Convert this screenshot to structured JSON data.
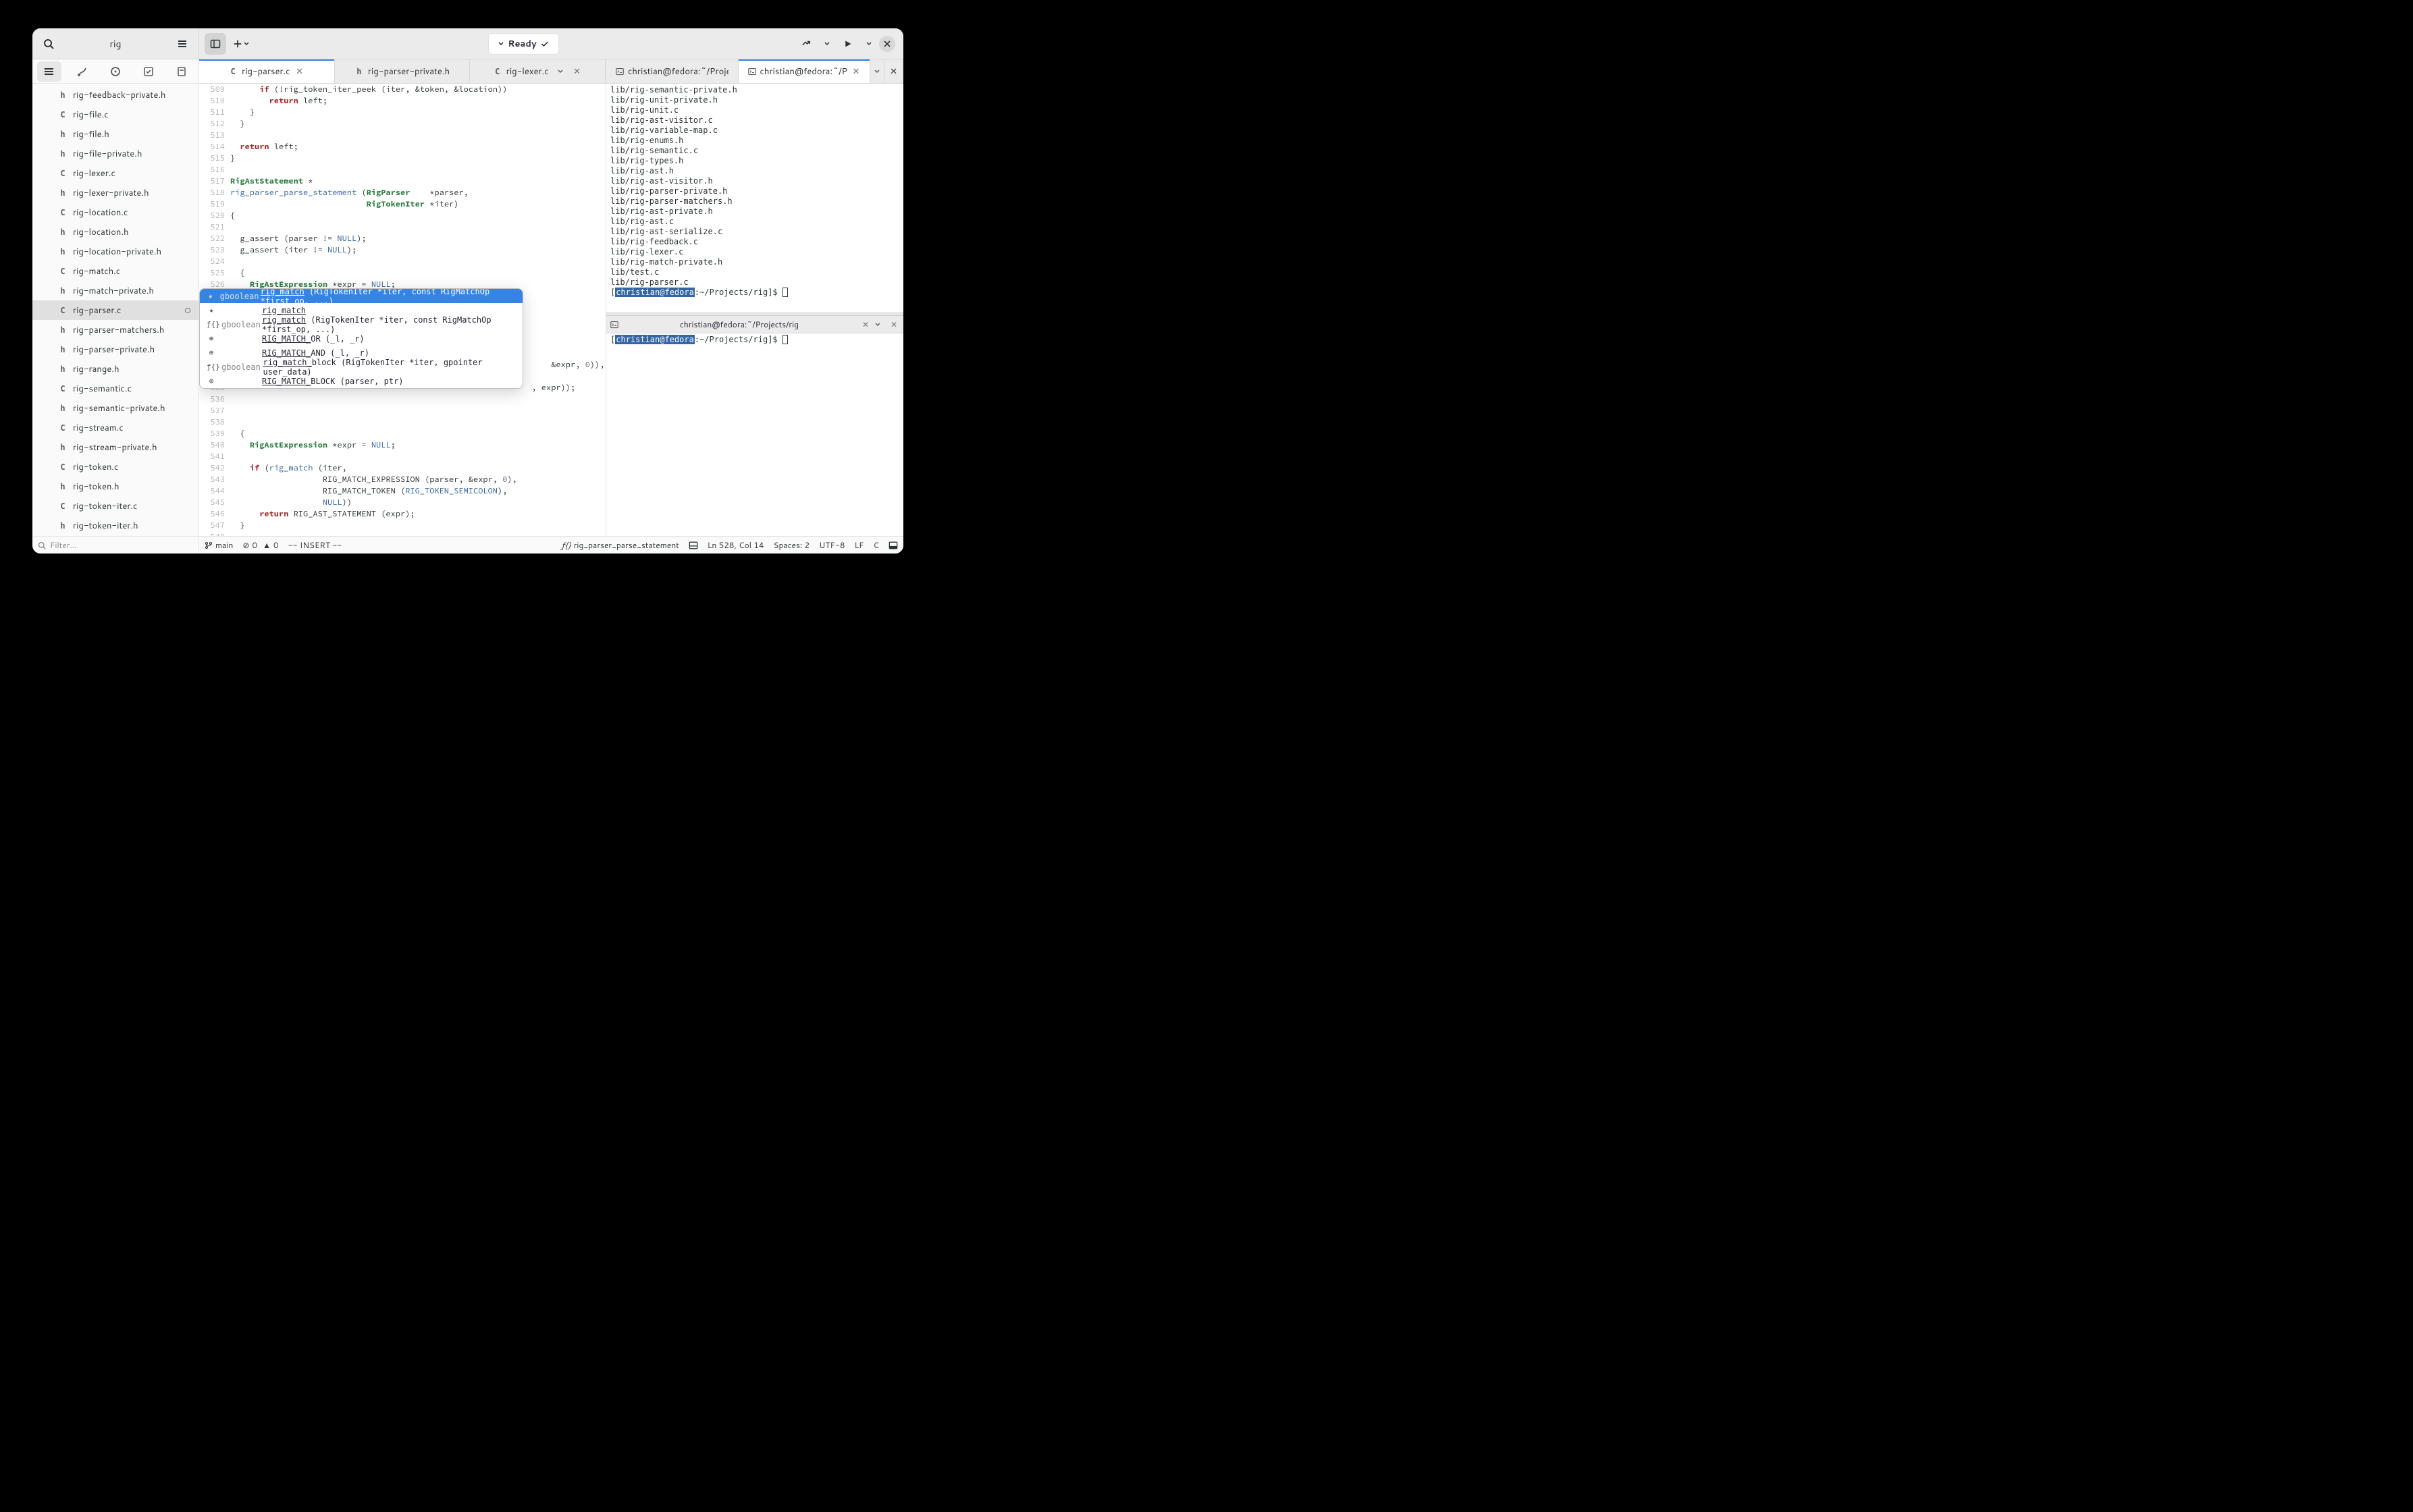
{
  "header": {
    "search_value": "rig",
    "center_status": "Ready"
  },
  "sidebar": {
    "filter_placeholder": "Filter…",
    "files": [
      {
        "icon": "h",
        "name": "rig-feedback-private.h"
      },
      {
        "icon": "C",
        "name": "rig-file.c"
      },
      {
        "icon": "h",
        "name": "rig-file.h"
      },
      {
        "icon": "h",
        "name": "rig-file-private.h"
      },
      {
        "icon": "C",
        "name": "rig-lexer.c"
      },
      {
        "icon": "h",
        "name": "rig-lexer-private.h"
      },
      {
        "icon": "C",
        "name": "rig-location.c"
      },
      {
        "icon": "h",
        "name": "rig-location.h"
      },
      {
        "icon": "h",
        "name": "rig-location-private.h"
      },
      {
        "icon": "C",
        "name": "rig-match.c"
      },
      {
        "icon": "h",
        "name": "rig-match-private.h"
      },
      {
        "icon": "C",
        "name": "rig-parser.c",
        "selected": true,
        "modified": true
      },
      {
        "icon": "h",
        "name": "rig-parser-matchers.h"
      },
      {
        "icon": "h",
        "name": "rig-parser-private.h"
      },
      {
        "icon": "h",
        "name": "rig-range.h"
      },
      {
        "icon": "C",
        "name": "rig-semantic.c"
      },
      {
        "icon": "h",
        "name": "rig-semantic-private.h"
      },
      {
        "icon": "C",
        "name": "rig-stream.c"
      },
      {
        "icon": "h",
        "name": "rig-stream-private.h"
      },
      {
        "icon": "C",
        "name": "rig-token.c"
      },
      {
        "icon": "h",
        "name": "rig-token.h"
      },
      {
        "icon": "C",
        "name": "rig-token-iter.c"
      },
      {
        "icon": "h",
        "name": "rig-token-iter.h"
      }
    ]
  },
  "editor_tabs": [
    {
      "icon": "C",
      "label": "rig-parser.c",
      "active": true,
      "close": true
    },
    {
      "icon": "h",
      "label": "rig-parser-private.h"
    },
    {
      "icon": "C",
      "label": "rig-lexer.c",
      "dropdown": true,
      "close": true
    }
  ],
  "terminal_tabs_top": [
    {
      "label": "christian@fedora:~/Projects/rig"
    },
    {
      "label": "christian@fedora:~/Projects",
      "active": true,
      "close": true,
      "dropdown": true,
      "close_panel": true
    }
  ],
  "terminal_tabs_bottom": {
    "label": "christian@fedora:~/Projects/rig"
  },
  "terminal1_lines": [
    "lib/rig-semantic-private.h",
    "lib/rig-unit-private.h",
    "lib/rig-unit.c",
    "lib/rig-ast-visitor.c",
    "lib/rig-variable-map.c",
    "lib/rig-enums.h",
    "lib/rig-semantic.c",
    "lib/rig-types.h",
    "lib/rig-ast.h",
    "lib/rig-ast-visitor.h",
    "lib/rig-parser-private.h",
    "lib/rig-parser-matchers.h",
    "lib/rig-ast-private.h",
    "lib/rig-ast.c",
    "lib/rig-ast-serialize.c",
    "lib/rig-feedback.c",
    "lib/rig-lexer.c",
    "lib/rig-match-private.h",
    "lib/test.c",
    "lib/rig-parser.c"
  ],
  "terminal1_prompt": {
    "user": "christian@fedora",
    "path": ":~/Projects/rig]$ "
  },
  "terminal2_prompt": {
    "user": "christian@fedora",
    "path": ":~/Projects/rig]$ "
  },
  "editor": {
    "first_line": 509,
    "cursor_line": 528,
    "typed": "rig_match"
  },
  "completion": [
    {
      "icon": "★",
      "ret": "gboolean",
      "text": "rig_match",
      "sig": " (RigTokenIter *iter, const RigMatchOp *first_op, ...)",
      "sel": true
    },
    {
      "icon": "★",
      "ret": "",
      "text": "rig_match",
      "sig": ""
    },
    {
      "icon": "ƒ{}",
      "ret": "gboolean",
      "text": "rig_match",
      "sig": " (RigTokenIter *iter, const RigMatchOp *first_op, ...)"
    },
    {
      "icon": "⊕",
      "ret": "",
      "text": "RIG_MATCH_",
      "sig": "OR (_l, _r)"
    },
    {
      "icon": "⊕",
      "ret": "",
      "text": "RIG_MATCH_",
      "sig": "AND (_l, _r)"
    },
    {
      "icon": "ƒ{}",
      "ret": "gboolean",
      "text": "rig_match_",
      "sig": "block (RigTokenIter *iter, gpointer user_data)"
    },
    {
      "icon": "⊕",
      "ret": "",
      "text": "RIG_MATCH_",
      "sig": "BLOCK (parser, ptr)"
    }
  ],
  "statusbar": {
    "branch": "main",
    "errors": "0",
    "warnings": "0",
    "mode": "-- INSERT --",
    "symbol": "rig_parser_parse_statement",
    "position": "Ln 528, Col 14",
    "indent": "Spaces: 2",
    "encoding": "UTF-8",
    "eol": "LF",
    "lang": "C"
  }
}
